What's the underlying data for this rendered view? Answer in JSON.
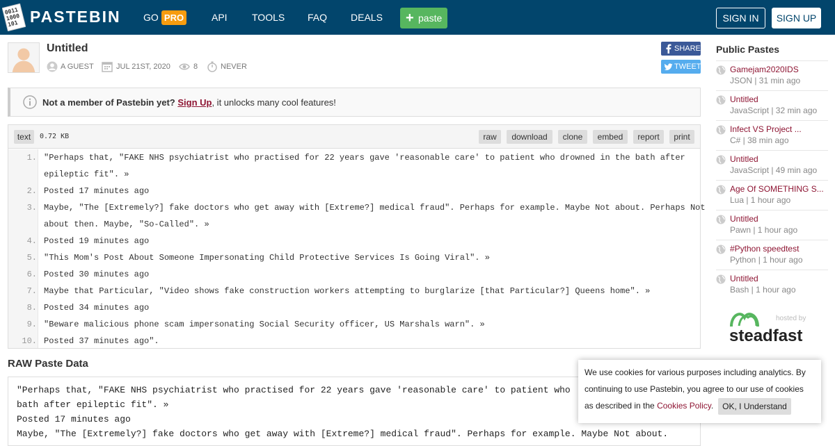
{
  "header": {
    "logo_text": "PASTEBIN",
    "nav": {
      "go": "GO",
      "pro": "PRO",
      "api": "API",
      "tools": "TOOLS",
      "faq": "FAQ",
      "deals": "DEALS"
    },
    "paste_button": "paste",
    "sign_in": "SIGN IN",
    "sign_up": "SIGN UP"
  },
  "paste": {
    "title": "Untitled",
    "author": "A GUEST",
    "date": "JUL 21ST, 2020",
    "views": "8",
    "expire": "NEVER",
    "share": "SHARE",
    "tweet": "TWEET"
  },
  "notice": {
    "bold": "Not a member of Pastebin yet?",
    "link": "Sign Up",
    "rest": ", it unlocks many cool features!"
  },
  "code": {
    "syntax": "text",
    "size": "0.72 KB",
    "actions": [
      "raw",
      "download",
      "clone",
      "embed",
      "report",
      "print"
    ],
    "lines": [
      {
        "n": "1.",
        "text": "\"Perhaps that, \"FAKE NHS psychiatrist who practised for 22 years gave 'reasonable care' to patient who drowned in the bath after"
      },
      {
        "n": "",
        "text": "epileptic fit\". »"
      },
      {
        "n": "2.",
        "text": "Posted 17 minutes ago"
      },
      {
        "n": "3.",
        "text": "Maybe, \"The [Extremely?] fake doctors who get away with [Extreme?] medical fraud\". Perhaps for example. Maybe Not about. Perhaps Not"
      },
      {
        "n": "",
        "text": "about then. Maybe, \"So-Called\". »"
      },
      {
        "n": "4.",
        "text": "Posted 19 minutes ago"
      },
      {
        "n": "5.",
        "text": "\"This Mom's Post About Someone Impersonating Child Protective Services Is Going Viral\". »"
      },
      {
        "n": "6.",
        "text": "Posted 30 minutes ago"
      },
      {
        "n": "7.",
        "text": "Maybe that Particular, \"Video shows fake construction workers attempting to burglarize [that Particular?] Queens home\". »"
      },
      {
        "n": "8.",
        "text": "Posted 34 minutes ago"
      },
      {
        "n": "9.",
        "text": "\"Beware malicious phone scam impersonating Social Security officer, US Marshals warn\". »"
      },
      {
        "n": "10.",
        "text": "Posted 37 minutes ago\"."
      }
    ]
  },
  "raw": {
    "title": "RAW Paste Data",
    "lines": [
      "\"Perhaps that, \"FAKE NHS psychiatrist who practised for 22 years gave 'reasonable care' to patient who",
      "bath after epileptic fit\". »",
      "Posted 17 minutes ago",
      "Maybe, \"The [Extremely?] fake doctors who get away with [Extreme?] medical fraud\". Perhaps for example. Maybe Not about."
    ]
  },
  "sidebar": {
    "title": "Public Pastes",
    "items": [
      {
        "title": "Gamejam2020IDS",
        "meta": "JSON | 31 min ago"
      },
      {
        "title": "Untitled",
        "meta": "JavaScript | 32 min ago"
      },
      {
        "title": "Infect VS Project ...",
        "meta": "C# | 38 min ago"
      },
      {
        "title": "Untitled",
        "meta": "JavaScript | 49 min ago"
      },
      {
        "title": "Age Of SOMETHING S...",
        "meta": "Lua | 1 hour ago"
      },
      {
        "title": "Untitled",
        "meta": "Pawn | 1 hour ago"
      },
      {
        "title": "#Python speedtest",
        "meta": "Python | 1 hour ago"
      },
      {
        "title": "Untitled",
        "meta": "Bash | 1 hour ago"
      }
    ],
    "hosted_by": "hosted by",
    "host_name": "steadfast"
  },
  "cookie": {
    "text": "We use cookies for various purposes including analytics. By continuing to use Pastebin, you agree to our use of cookies as described in the ",
    "link": "Cookies Policy",
    "end": ".",
    "button": "OK, I Understand"
  },
  "colors": {
    "header_bg": "#02456c",
    "pro_badge": "#f79c0f",
    "paste_button": "#57b65f",
    "link": "#8e1533",
    "facebook": "#3b5998",
    "twitter": "#55acee"
  },
  "icons": {
    "logo": "pastebin-logo-icon",
    "plus": "plus-icon",
    "user": "user-icon",
    "calendar": "calendar-icon",
    "eye": "eye-icon",
    "timer": "stopwatch-icon",
    "info": "info-icon",
    "facebook": "facebook-icon",
    "twitter": "twitter-icon",
    "globe": "globe-icon",
    "steadfast": "steadfast-logo-icon"
  }
}
